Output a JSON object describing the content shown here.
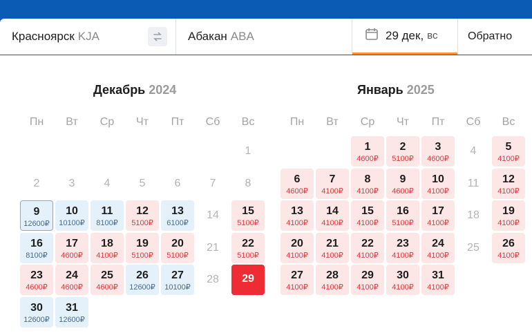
{
  "search": {
    "origin_city": "Красноярск",
    "origin_code": "KJA",
    "dest_city": "Абакан",
    "dest_code": "ABA",
    "date": "29 дек,",
    "date_dow": "вс",
    "return_label": "Обратно",
    "swap_icon": "swap-arrows-icon",
    "calendar_icon": "calendar-icon"
  },
  "weekdays": [
    "Пн",
    "Вт",
    "Ср",
    "Чт",
    "Пт",
    "Сб",
    "Вс"
  ],
  "colors": {
    "header_blue": "#0b5bb5",
    "accent_orange": "#ff8e2b",
    "price_red": "#e0393c",
    "cheap_blue_bg": "#e4f1fb",
    "selected_red": "#ef2b34"
  },
  "months": [
    {
      "name": "Декабрь",
      "year": "2024",
      "days": [
        {
          "day": "1",
          "price": "",
          "style": "plain"
        },
        {
          "day": "2",
          "price": "",
          "style": "plain"
        },
        {
          "day": "3",
          "price": "",
          "style": "plain"
        },
        {
          "day": "4",
          "price": "",
          "style": "plain"
        },
        {
          "day": "5",
          "price": "",
          "style": "plain"
        },
        {
          "day": "6",
          "price": "",
          "style": "plain"
        },
        {
          "day": "7",
          "price": "",
          "style": "plain"
        },
        {
          "day": "8",
          "price": "",
          "style": "plain"
        },
        {
          "day": "9",
          "price": "12600₽",
          "style": "blue sel"
        },
        {
          "day": "10",
          "price": "10100₽",
          "style": "blue"
        },
        {
          "day": "11",
          "price": "8100₽",
          "style": "blue"
        },
        {
          "day": "12",
          "price": "5100₽",
          "style": "red"
        },
        {
          "day": "13",
          "price": "6100₽",
          "style": "blue"
        },
        {
          "day": "14",
          "price": "",
          "style": "plain"
        },
        {
          "day": "15",
          "price": "5100₽",
          "style": "red"
        },
        {
          "day": "16",
          "price": "8100₽",
          "style": "blue"
        },
        {
          "day": "17",
          "price": "4600₽",
          "style": "red"
        },
        {
          "day": "18",
          "price": "4100₽",
          "style": "red"
        },
        {
          "day": "19",
          "price": "5100₽",
          "style": "red"
        },
        {
          "day": "20",
          "price": "5100₽",
          "style": "red"
        },
        {
          "day": "21",
          "price": "",
          "style": "plain"
        },
        {
          "day": "22",
          "price": "5100₽",
          "style": "red"
        },
        {
          "day": "23",
          "price": "4600₽",
          "style": "red"
        },
        {
          "day": "24",
          "price": "4600₽",
          "style": "red"
        },
        {
          "day": "25",
          "price": "4600₽",
          "style": "red"
        },
        {
          "day": "26",
          "price": "12600₽",
          "style": "blue"
        },
        {
          "day": "27",
          "price": "10100₽",
          "style": "blue"
        },
        {
          "day": "28",
          "price": "",
          "style": "plain"
        },
        {
          "day": "29",
          "price": "",
          "style": "active"
        },
        {
          "day": "30",
          "price": "12600₽",
          "style": "blue"
        },
        {
          "day": "31",
          "price": "12600₽",
          "style": "blue"
        }
      ]
    },
    {
      "name": "Январь",
      "year": "2025",
      "days": [
        {
          "day": "1",
          "price": "4600₽",
          "style": "red"
        },
        {
          "day": "2",
          "price": "5100₽",
          "style": "red"
        },
        {
          "day": "3",
          "price": "4600₽",
          "style": "red"
        },
        {
          "day": "4",
          "price": "",
          "style": "plain"
        },
        {
          "day": "5",
          "price": "4100₽",
          "style": "red"
        },
        {
          "day": "6",
          "price": "4600₽",
          "style": "red"
        },
        {
          "day": "7",
          "price": "4100₽",
          "style": "red"
        },
        {
          "day": "8",
          "price": "4100₽",
          "style": "red"
        },
        {
          "day": "9",
          "price": "4600₽",
          "style": "red"
        },
        {
          "day": "10",
          "price": "4100₽",
          "style": "red"
        },
        {
          "day": "11",
          "price": "",
          "style": "plain"
        },
        {
          "day": "12",
          "price": "4100₽",
          "style": "red"
        },
        {
          "day": "13",
          "price": "4100₽",
          "style": "red"
        },
        {
          "day": "14",
          "price": "4100₽",
          "style": "red"
        },
        {
          "day": "15",
          "price": "4100₽",
          "style": "red"
        },
        {
          "day": "16",
          "price": "5100₽",
          "style": "red"
        },
        {
          "day": "17",
          "price": "4100₽",
          "style": "red"
        },
        {
          "day": "18",
          "price": "",
          "style": "plain"
        },
        {
          "day": "19",
          "price": "4100₽",
          "style": "red"
        },
        {
          "day": "20",
          "price": "4100₽",
          "style": "red"
        },
        {
          "day": "21",
          "price": "4100₽",
          "style": "red"
        },
        {
          "day": "22",
          "price": "4100₽",
          "style": "red"
        },
        {
          "day": "23",
          "price": "4100₽",
          "style": "red"
        },
        {
          "day": "24",
          "price": "4100₽",
          "style": "red"
        },
        {
          "day": "25",
          "price": "",
          "style": "plain"
        },
        {
          "day": "26",
          "price": "4100₽",
          "style": "red"
        },
        {
          "day": "27",
          "price": "4100₽",
          "style": "red"
        },
        {
          "day": "28",
          "price": "4100₽",
          "style": "red"
        },
        {
          "day": "29",
          "price": "4100₽",
          "style": "red"
        },
        {
          "day": "30",
          "price": "4100₽",
          "style": "red"
        },
        {
          "day": "31",
          "price": "4100₽",
          "style": "red"
        }
      ]
    }
  ]
}
